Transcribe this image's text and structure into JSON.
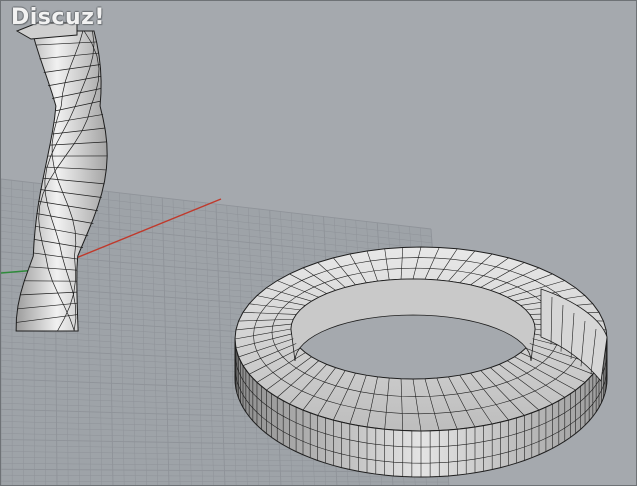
{
  "viewport": {
    "background": "#a5a9ae",
    "grid_color": "#8f9399",
    "axis_x_color": "#c0392b",
    "axis_y_color": "#2e8b3a",
    "surface_fill": "#dcdcdc",
    "surface_shade": "#9a9a9a",
    "mesh_line": "#1e1e1e"
  },
  "watermark": {
    "text": "Discuz!"
  },
  "objects": [
    {
      "name": "twisted-column",
      "icon": "twisted-column-mesh"
    },
    {
      "name": "mobius-ring",
      "icon": "mobius-ring-mesh"
    }
  ]
}
